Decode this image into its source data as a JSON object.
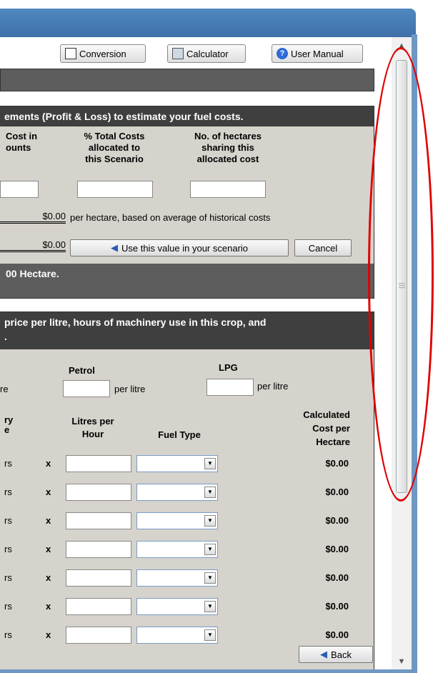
{
  "toolbar": {
    "conversion": "Conversion",
    "calculator": "Calculator",
    "manual": "User Manual"
  },
  "panel1": {
    "header": "ements (Profit & Loss) to estimate your fuel costs.",
    "col1": [
      "Cost in",
      "ounts"
    ],
    "col2": [
      "% Total Costs",
      "allocated to",
      "this Scenario"
    ],
    "col3": [
      "No. of hectares",
      "sharing this",
      "allocated cost"
    ],
    "cost1": "$0.00",
    "note": "per hectare, based on average of historical costs",
    "cost2": "$0.00",
    "use_button": "Use this value in your scenario",
    "cancel_button": "Cancel",
    "footer": "00 Hectare."
  },
  "panel2": {
    "header": [
      "price per litre, hours of machinery use in this crop, and",
      "."
    ],
    "petrol": "Petrol",
    "lpg": "LPG",
    "re": "re",
    "per_litre": "per litre",
    "col_ry": "ry",
    "col_e": "e",
    "col_litres": [
      "Litres per",
      "Hour"
    ],
    "col_fuel": "Fuel Type",
    "col_calc": [
      "Calculated",
      "Cost per",
      "Hectare"
    ],
    "rows": [
      {
        "rs": "rs",
        "x": "x",
        "cost": "$0.00"
      },
      {
        "rs": "rs",
        "x": "x",
        "cost": "$0.00"
      },
      {
        "rs": "rs",
        "x": "x",
        "cost": "$0.00"
      },
      {
        "rs": "rs",
        "x": "x",
        "cost": "$0.00"
      },
      {
        "rs": "rs",
        "x": "x",
        "cost": "$0.00"
      },
      {
        "rs": "rs",
        "x": "x",
        "cost": "$0.00"
      },
      {
        "rs": "rs",
        "x": "x",
        "cost": "$0.00"
      }
    ]
  },
  "back_button": "Back",
  "icons": [
    "ruler-icon",
    "calculator-icon",
    "help-icon",
    "arrow-left-icon",
    "chevron-down-icon"
  ],
  "colors": {
    "header_dark": "#3f3f3f",
    "panel_bg": "#d6d3cc",
    "annotation": "#e00000",
    "titlebar": "#4f88c0"
  }
}
